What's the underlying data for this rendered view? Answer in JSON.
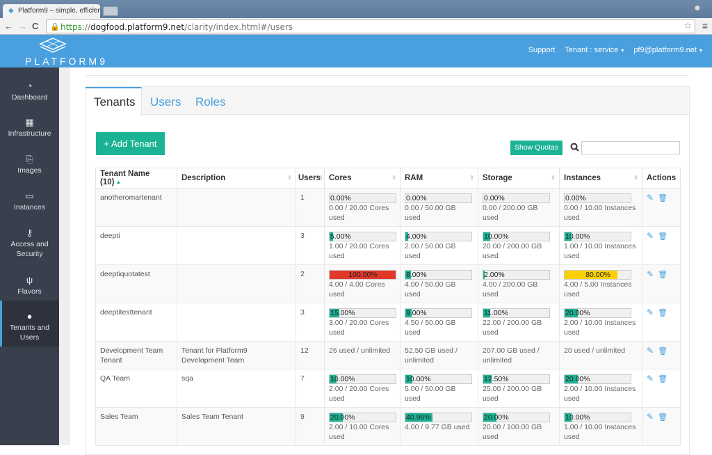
{
  "browser": {
    "tab_title": "Platform9 – simple, efficien",
    "tab_close": "×",
    "url_scheme": "https",
    "url_sep": "://",
    "url_host": "dogfood.platform9.net",
    "url_path": "/clarity/index.html#/users",
    "back": "←",
    "forward": "→",
    "reload": "C",
    "star": "☆",
    "menu": "≡"
  },
  "appbar": {
    "logo_text": "PLATFORM9",
    "support": "Support",
    "tenant": "Tenant : service",
    "user": "pf9@platform9.net",
    "caret": "▾"
  },
  "sidebar": {
    "items": [
      {
        "label": "Dashboard",
        "icon": "◔"
      },
      {
        "label": "Infrastructure",
        "icon": "▦"
      },
      {
        "label": "Images",
        "icon": "⎘"
      },
      {
        "label": "Instances",
        "icon": "▭"
      },
      {
        "label": "Access and Security",
        "icon": "⚷"
      },
      {
        "label": "Flavors",
        "icon": "ψ"
      },
      {
        "label": "Tenants and Users",
        "icon": "●",
        "active": true
      }
    ]
  },
  "tabs": [
    {
      "label": "Tenants",
      "active": true
    },
    {
      "label": "Users"
    },
    {
      "label": "Roles"
    }
  ],
  "actions": {
    "add_tenant": "+ Add Tenant",
    "show_quotas": "Show Quotas",
    "search_icon": "⚲",
    "search_value": ""
  },
  "table": {
    "headers": [
      "Tenant Name (10)",
      "Description",
      "Users",
      "Cores",
      "RAM",
      "Storage",
      "Instances",
      "Actions"
    ],
    "rows": [
      {
        "name": "anotheromartenant",
        "desc": "",
        "users": "1",
        "cores": {
          "pct": 0,
          "label": "0.00%",
          "usage": "0.00 / 20.00 Cores used"
        },
        "ram": {
          "pct": 0,
          "label": "0.00%",
          "usage": "0.00 / 50.00 GB used"
        },
        "storage": {
          "pct": 0,
          "label": "0.00%",
          "usage": "0.00 / 200.00 GB used"
        },
        "instances": {
          "pct": 0,
          "label": "0.00%",
          "usage": "0.00 / 10.00 Instances used"
        }
      },
      {
        "name": "deepti",
        "desc": "",
        "users": "3",
        "cores": {
          "pct": 5,
          "label": "5.00%",
          "usage": "1.00 / 20.00 Cores used"
        },
        "ram": {
          "pct": 4,
          "label": "4.00%",
          "usage": "2.00 / 50.00 GB used"
        },
        "storage": {
          "pct": 10,
          "label": "10.00%",
          "usage": "20.00 / 200.00 GB used"
        },
        "instances": {
          "pct": 10,
          "label": "10.00%",
          "usage": "1.00 / 10.00 Instances used"
        }
      },
      {
        "name": "deeptiquotatest",
        "desc": "",
        "users": "2",
        "cores": {
          "pct": 100,
          "label": "100.00%",
          "usage": "4.00 / 4.00 Cores used",
          "level": "red"
        },
        "ram": {
          "pct": 8,
          "label": "8.00%",
          "usage": "4.00 / 50.00 GB used"
        },
        "storage": {
          "pct": 2,
          "label": "2.00%",
          "usage": "4.00 / 200.00 GB used"
        },
        "instances": {
          "pct": 80,
          "label": "80.00%",
          "usage": "4.00 / 5.00 Instances used",
          "level": "yellow"
        }
      },
      {
        "name": "deeptitesttenant",
        "desc": "",
        "users": "3",
        "cores": {
          "pct": 15,
          "label": "15.00%",
          "usage": "3.00 / 20.00 Cores used"
        },
        "ram": {
          "pct": 9,
          "label": "9.00%",
          "usage": "4.50 / 50.00 GB used"
        },
        "storage": {
          "pct": 11,
          "label": "11.00%",
          "usage": "22.00 / 200.00 GB used"
        },
        "instances": {
          "pct": 20,
          "label": "20.00%",
          "usage": "2.00 / 10.00 Instances used"
        }
      },
      {
        "name": "Development Team Tenant",
        "desc": "Tenant for Platform9 Development Team",
        "users": "12",
        "cores": {
          "text": "26 used / unlimited"
        },
        "ram": {
          "text": "52.50 GB used / unlimited"
        },
        "storage": {
          "text": "207.00 GB used / unlimited"
        },
        "instances": {
          "text": "20 used / unlimited"
        }
      },
      {
        "name": "QA Team",
        "desc": "sqa",
        "users": "7",
        "cores": {
          "pct": 10,
          "label": "10.00%",
          "usage": "2.00 / 20.00 Cores used"
        },
        "ram": {
          "pct": 10,
          "label": "10.00%",
          "usage": "5.00 / 50.00 GB used"
        },
        "storage": {
          "pct": 12.5,
          "label": "12.50%",
          "usage": "25.00 / 200.00 GB used"
        },
        "instances": {
          "pct": 20,
          "label": "20.00%",
          "usage": "2.00 / 10.00 Instances used"
        }
      },
      {
        "name": "Sales Team",
        "desc": "Sales Team Tenant",
        "users": "9",
        "cores": {
          "pct": 20,
          "label": "20.00%",
          "usage": "2.00 / 10.00 Cores used"
        },
        "ram": {
          "pct": 40.96,
          "label": "40.96%",
          "usage": "4.00 / 9.77 GB used"
        },
        "storage": {
          "pct": 20,
          "label": "20.00%",
          "usage": "20.00 / 100.00 GB used"
        },
        "instances": {
          "pct": 10,
          "label": "10.00%",
          "usage": "1.00 / 10.00 Instances used"
        }
      }
    ],
    "edit_icon": "✎",
    "delete_icon": "🗑"
  }
}
